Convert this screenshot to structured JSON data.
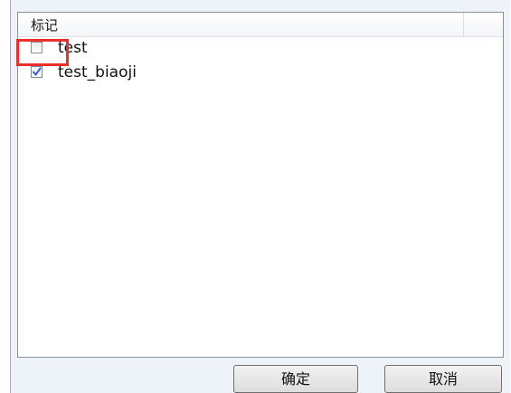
{
  "list": {
    "column_header": "标记",
    "items": [
      {
        "label": "test",
        "checked": false
      },
      {
        "label": "test_biaoji",
        "checked": true
      }
    ]
  },
  "buttons": {
    "ok_label": "确定",
    "cancel_label": "取消"
  },
  "colors": {
    "highlight": "#e8312a",
    "check_mark": "#3a5fcd"
  }
}
